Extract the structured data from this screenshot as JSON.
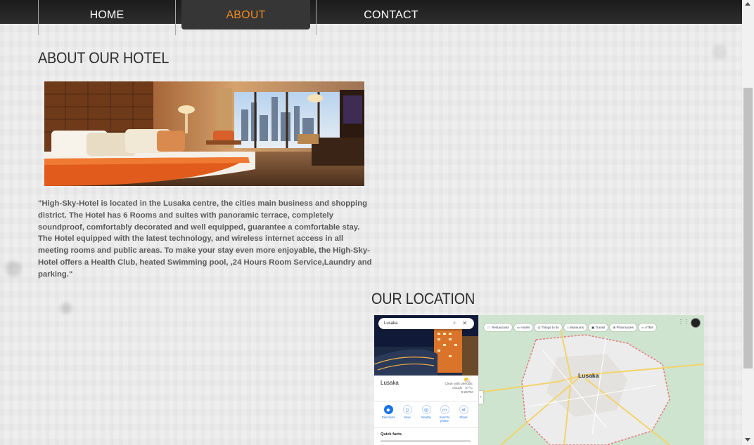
{
  "nav": {
    "items": [
      {
        "label": "HOME"
      },
      {
        "label": "ABOUT"
      },
      {
        "label": "CONTACT"
      }
    ],
    "active": "ABOUT",
    "active_color": "#f08a1c"
  },
  "about": {
    "heading": "ABOUT OUR HOTEL",
    "image_alt": "hotel-room-photo",
    "text": "\"High-Sky-Hotel is located in the Lusaka centre, the cities main business and shopping district. The Hotel has 6 Rooms and suites with panoramic terrace, completely soundproof, comfortably decorated and well equipped, guarantee a comfortable stay. The Hotel equipped with the latest technology, and wireless internet access in all meeting rooms and public areas. To make your stay even more enjoyable, the High-Sky-Hotel offers a Health Club, heated Swimming pool, ,24 Hours Room Service,Laundry and parking.\""
  },
  "location": {
    "heading": "OUR LOCATION",
    "map": {
      "search_value": "Lusaka",
      "place_name": "Lusaka",
      "weather": "Clear with periodic clouds · 27°C 9:24PM",
      "actions": [
        {
          "label": "Directions",
          "icon": "directions-icon"
        },
        {
          "label": "Save",
          "icon": "bookmark-icon"
        },
        {
          "label": "Nearby",
          "icon": "nearby-icon"
        },
        {
          "label": "Send to phone",
          "icon": "phone-icon"
        },
        {
          "label": "Share",
          "icon": "share-icon"
        }
      ],
      "quick_facts": "Quick facts",
      "chips": [
        "Restaurants",
        "Hotels",
        "Things to do",
        "Museums",
        "Transit",
        "Pharmacies",
        "ATMs"
      ],
      "city_label": "Lusaka"
    }
  }
}
